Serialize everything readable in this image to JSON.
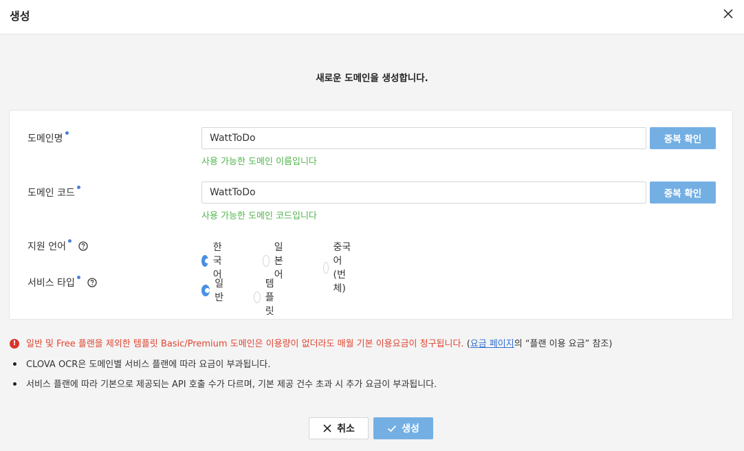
{
  "dialog": {
    "title": "생성",
    "subtitle": "새로운 도메인을 생성합니다."
  },
  "form": {
    "domain_name": {
      "label": "도메인명",
      "value": "WattToDo",
      "check_button": "중복 확인",
      "status_message": "사용 가능한 도메인 이름입니다"
    },
    "domain_code": {
      "label": "도메인 코드",
      "value": "WattToDo",
      "check_button": "중복 확인",
      "status_message": "사용 가능한 도메인 코드입니다"
    },
    "language": {
      "label": "지원 언어",
      "options": [
        "한국어",
        "일본어",
        "중국어(번체)"
      ],
      "selected": "한국어"
    },
    "service_type": {
      "label": "서비스 타입",
      "options": [
        "일반",
        "템플릿"
      ],
      "selected": "일반"
    }
  },
  "notes": {
    "warning_text": "일반 및 Free 플랜을 제외한 템플릿 Basic/Premium 도메인은 이용량이 없더라도 매월 기본 이용요금이 청구됩니다.",
    "warning_paren_open": "(",
    "warning_link": "요금 페이지",
    "warning_suffix": "의 “플랜 이용 요금” 참조)",
    "bullet1": "CLOVA OCR은 도메인별 서비스 플랜에 따라 요금이 부과됩니다.",
    "bullet2": "서비스 플랜에 따라 기본으로 제공되는 API 호출 수가 다르며, 기본 제공 건수 초과 시 추가 요금이 부과됩니다."
  },
  "footer": {
    "cancel_label": "취소",
    "create_label": "생성"
  },
  "colors": {
    "primary": "#74afe3",
    "radio_selected": "#4a90e2",
    "success": "#4fb54a",
    "warning": "#e0452f",
    "required_dot": "#4a7fd6"
  }
}
